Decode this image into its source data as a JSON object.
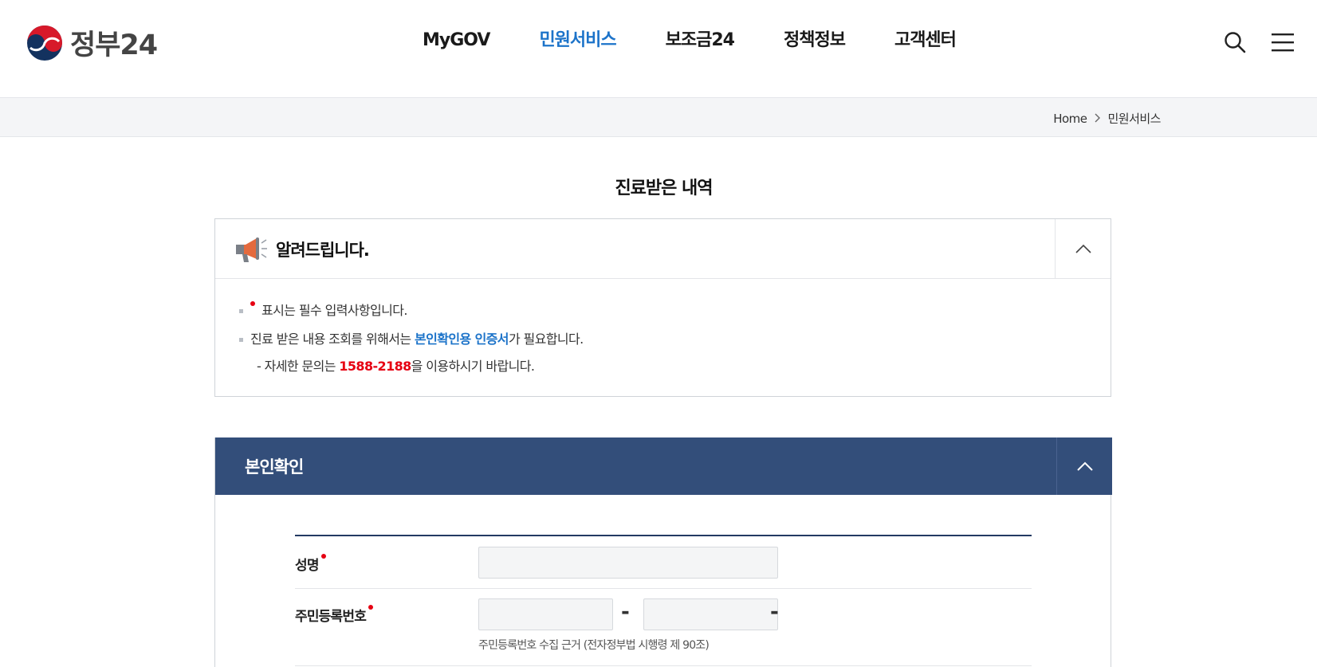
{
  "header": {
    "logo_text": "정부24",
    "nav": [
      {
        "label": "MyGOV",
        "active": false
      },
      {
        "label": "민원서비스",
        "active": true
      },
      {
        "label": "보조금24",
        "active": false
      },
      {
        "label": "정책정보",
        "active": false
      },
      {
        "label": "고객센터",
        "active": false
      }
    ],
    "icons": [
      "search-icon",
      "menu-icon"
    ]
  },
  "breadcrumb": {
    "home": "Home",
    "current": "민원서비스"
  },
  "page_title": "진료받은 내역",
  "notice": {
    "title": "알려드립니다.",
    "line1_text": "표시는 필수 입력사항입니다.",
    "line2_pre": "진료 받은 내용 조회를 위해서는 ",
    "line2_link": "본인확인용 인증서",
    "line2_post": "가 필요합니다.",
    "line3_pre": "- 자세한 문의는 ",
    "line3_phone": "1588-2188",
    "line3_post": "을 이용하시기 바랍니다."
  },
  "identity": {
    "title": "본인확인",
    "name_label": "성명",
    "name_value": "",
    "rrn_label": "주민등록번호",
    "rrn_front_value": "",
    "rrn_back_value": "",
    "rrn_sep": "-",
    "rrn_help": "주민등록번호 수집 근거 (전자정부법 시행령 제 90조)"
  },
  "colors": {
    "accent_blue": "#1c73c9",
    "section_header": "#334e7a",
    "required_red": "#e60012"
  }
}
